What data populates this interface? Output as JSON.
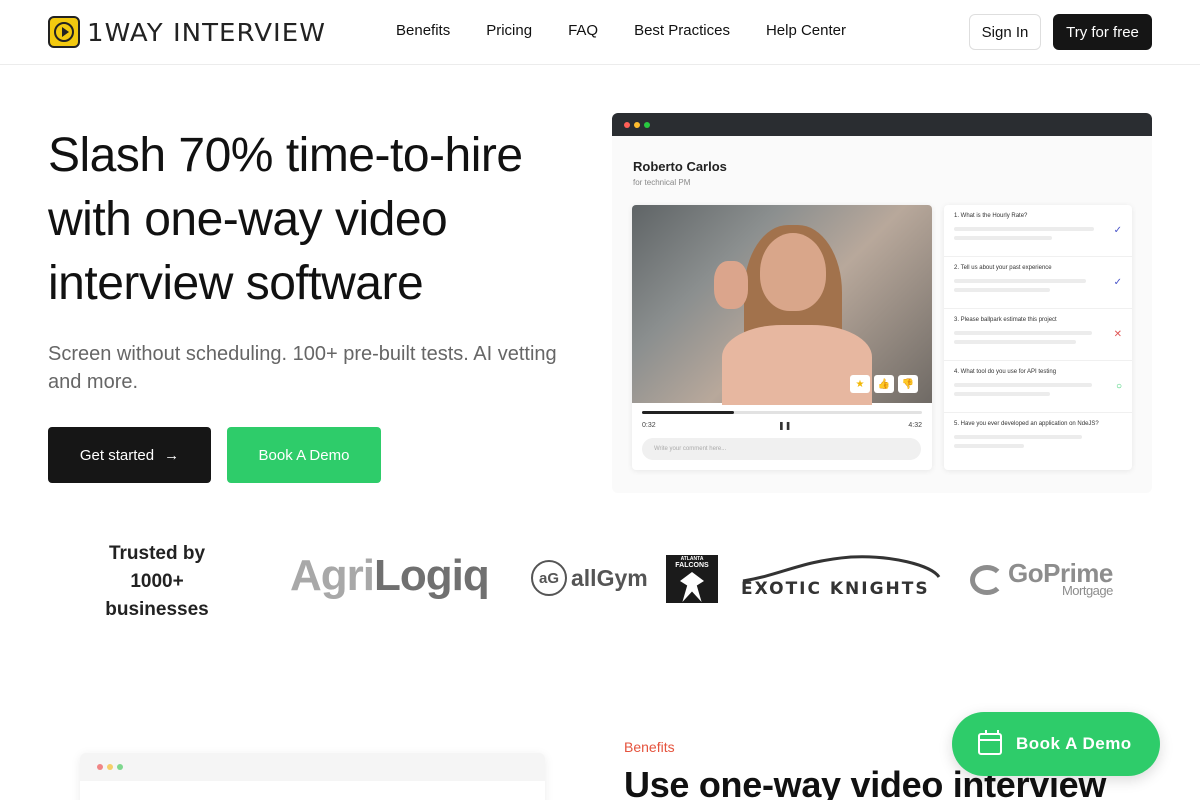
{
  "brand": {
    "name": "1WAY INTERVIEW"
  },
  "nav": {
    "links": [
      "Benefits",
      "Pricing",
      "FAQ",
      "Best Practices",
      "Help Center"
    ],
    "sign_in": "Sign In",
    "try_free": "Try for free"
  },
  "hero": {
    "title": "Slash 70% time-to-hire with one-way video interview software",
    "subtitle": "Screen without scheduling. 100+ pre-built tests. AI vetting and more.",
    "cta_primary": "Get started",
    "cta_secondary": "Book A Demo"
  },
  "mockup": {
    "candidate_name": "Roberto Carlos",
    "candidate_role": "for technical PM",
    "time_elapsed": "0:32",
    "time_total": "4:32",
    "progress": 0.33,
    "comment_placeholder": "Write your comment here...",
    "questions": [
      {
        "text": "1. What is the Hourly Rate?",
        "status": "check"
      },
      {
        "text": "2. Tell us about your past experience",
        "status": "check"
      },
      {
        "text": "3. Please ballpark estimate this project",
        "status": "cross"
      },
      {
        "text": "4. What tool do you use for API testing",
        "status": "pending"
      },
      {
        "text": "5. Have you ever developed an application on NdeJS?",
        "status": "none"
      }
    ]
  },
  "trusted": {
    "label": "Trusted by 1000+ businesses",
    "logos": {
      "agri_a": "Agri",
      "agri_b": "Logiq",
      "allgym_mark": "aG",
      "allgym": "allGym",
      "falcons_small": "ATLANTA",
      "falcons": "FALCONS",
      "exotic": "EXOTIC KNIGHTS",
      "goprime": "GoPrime",
      "goprime_sub": "Mortgage"
    }
  },
  "section2": {
    "label": "Benefits",
    "title": "Use one-way video interview"
  },
  "floating": {
    "label": "Book A Demo"
  },
  "colors": {
    "accent_green": "#2ecc6a",
    "dark": "#151515",
    "benefits_red": "#e5533d",
    "logo_yellow": "#f2c90f"
  }
}
